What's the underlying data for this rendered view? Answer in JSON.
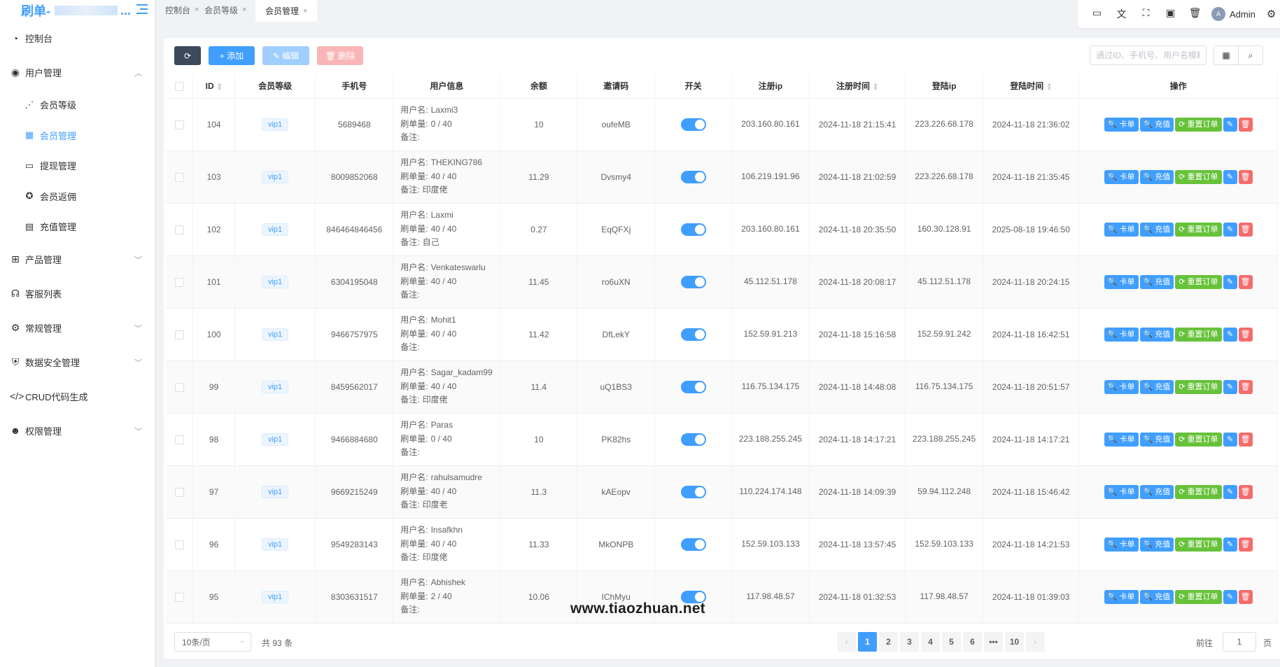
{
  "brand": {
    "title": "刷单-",
    "dots": "..."
  },
  "sidebar": {
    "items": [
      {
        "icon": "dashboard-icon",
        "glyph": "◔",
        "label": "控制台"
      },
      {
        "icon": "user-icon",
        "glyph": "◉",
        "label": "用户管理",
        "expanded": true,
        "children": [
          {
            "icon": "level-icon",
            "glyph": "⋰",
            "label": "会员等级"
          },
          {
            "icon": "grid-icon",
            "glyph": "▦",
            "label": "会员管理",
            "active": true
          },
          {
            "icon": "card-icon",
            "glyph": "▭",
            "label": "提现管理"
          },
          {
            "icon": "rebate-icon",
            "glyph": "✪",
            "label": "会员返佣"
          },
          {
            "icon": "briefcase-icon",
            "glyph": "▤",
            "label": "充值管理"
          }
        ]
      },
      {
        "icon": "product-icon",
        "glyph": "⊞",
        "label": "产品管理",
        "collapsed": true
      },
      {
        "icon": "headset-icon",
        "glyph": "☊",
        "label": "客服列表"
      },
      {
        "icon": "gears-icon",
        "glyph": "⚙",
        "label": "常规管理",
        "collapsed": true
      },
      {
        "icon": "shield-icon",
        "glyph": "⛨",
        "label": "数据安全管理",
        "collapsed": true
      },
      {
        "icon": "code-icon",
        "glyph": "</>",
        "label": "CRUD代码生成"
      },
      {
        "icon": "users-icon",
        "glyph": "☻",
        "label": "权限管理",
        "collapsed": true
      }
    ]
  },
  "tabs": [
    {
      "label": "控制台",
      "close": "×"
    },
    {
      "label": "会员等级",
      "close": "×"
    },
    {
      "label": "会员管理",
      "close": "×",
      "active": true
    }
  ],
  "topbar": {
    "icons": [
      "monitor-icon",
      "translate-icon",
      "fullscreen-icon",
      "terminal-icon",
      "trash-icon"
    ],
    "glyphs": [
      "▭",
      "文",
      "⛶",
      "▣",
      "🗑"
    ],
    "avatar_text": "A",
    "user": "Admin"
  },
  "toolbar": {
    "refresh": "⟳",
    "add": "+ 添加",
    "edit": "✎ 编辑",
    "delete": "🗑 删除",
    "search_placeholder": "通过ID、手机号、用户名模糊"
  },
  "table": {
    "columns": [
      "ID",
      "会员等级",
      "手机号",
      "用户信息",
      "余额",
      "邀请码",
      "开关",
      "注册ip",
      "注册时间",
      "登陆ip",
      "登陆时间",
      "操作"
    ],
    "info_labels": {
      "username": "用户名:",
      "orders": "刷单量:",
      "note": "备注:"
    },
    "op_labels": {
      "card": "🔍 卡单",
      "recharge": "🔍 充值",
      "reset": "⟳ 重置订单"
    },
    "rows": [
      {
        "id": "104",
        "level": "vip1",
        "phone": "5689468",
        "username": "Laxmi3",
        "orders": "0 / 40",
        "note": "",
        "balance": "10",
        "code": "oufeMB",
        "reg_ip": "203.160.80.161",
        "reg_time": "2024-11-18 21:15:41",
        "login_ip": "223.226.68.178",
        "login_time": "2024-11-18 21:36:02"
      },
      {
        "id": "103",
        "level": "vip1",
        "phone": "8009852068",
        "username": "THEKING786",
        "orders": "40 / 40",
        "note": "印度佬",
        "balance": "11.29",
        "code": "Dvsmy4",
        "reg_ip": "106.219.191.96",
        "reg_time": "2024-11-18 21:02:59",
        "login_ip": "223.226.68.178",
        "login_time": "2024-11-18 21:35:45"
      },
      {
        "id": "102",
        "level": "vip1",
        "phone": "846464846456",
        "username": "Laxmi",
        "orders": "40 / 40",
        "note": "自己",
        "balance": "0.27",
        "code": "EqQFXj",
        "reg_ip": "203.160.80.161",
        "reg_time": "2024-11-18 20:35:50",
        "login_ip": "160.30.128.91",
        "login_time": "2025-08-18 19:46:50"
      },
      {
        "id": "101",
        "level": "vip1",
        "phone": "6304195048",
        "username": "Venkateswarlu",
        "orders": "40 / 40",
        "note": "",
        "balance": "11.45",
        "code": "ro6uXN",
        "reg_ip": "45.112.51.178",
        "reg_time": "2024-11-18 20:08:17",
        "login_ip": "45.112.51.178",
        "login_time": "2024-11-18 20:24:15"
      },
      {
        "id": "100",
        "level": "vip1",
        "phone": "9466757975",
        "username": "Mohit1",
        "orders": "40 / 40",
        "note": "",
        "balance": "11.42",
        "code": "DfLekY",
        "reg_ip": "152.59.91.213",
        "reg_time": "2024-11-18 15:16:58",
        "login_ip": "152.59.91.242",
        "login_time": "2024-11-18 16:42:51"
      },
      {
        "id": "99",
        "level": "vip1",
        "phone": "8459562017",
        "username": "Sagar_kadam99",
        "orders": "40 / 40",
        "note": "印度佬",
        "balance": "11.4",
        "code": "uQ1BS3",
        "reg_ip": "116.75.134.175",
        "reg_time": "2024-11-18 14:48:08",
        "login_ip": "116.75.134.175",
        "login_time": "2024-11-18 20:51:57"
      },
      {
        "id": "98",
        "level": "vip1",
        "phone": "9466884680",
        "username": "Paras",
        "orders": "0 / 40",
        "note": "",
        "balance": "10",
        "code": "PK82hs",
        "reg_ip": "223.188.255.245",
        "reg_time": "2024-11-18 14:17:21",
        "login_ip": "223.188.255.245",
        "login_time": "2024-11-18 14:17:21"
      },
      {
        "id": "97",
        "level": "vip1",
        "phone": "9669215249",
        "username": "rahulsamudre",
        "orders": "40 / 40",
        "note": "印度老",
        "balance": "11.3",
        "code": "kAEopv",
        "reg_ip": "110.224.174.148",
        "reg_time": "2024-11-18 14:09:39",
        "login_ip": "59.94.112.248",
        "login_time": "2024-11-18 15:46:42"
      },
      {
        "id": "96",
        "level": "vip1",
        "phone": "9549283143",
        "username": "Insafkhn",
        "orders": "40 / 40",
        "note": "印度佬",
        "balance": "11.33",
        "code": "MkONPB",
        "reg_ip": "152.59.103.133",
        "reg_time": "2024-11-18 13:57:45",
        "login_ip": "152.59.103.133",
        "login_time": "2024-11-18 14:21:53"
      },
      {
        "id": "95",
        "level": "vip1",
        "phone": "8303631517",
        "username": "Abhishek",
        "orders": "2 / 40",
        "note": "",
        "balance": "10.06",
        "code": "IChMyu",
        "reg_ip": "117.98.48.57",
        "reg_time": "2024-11-18 01:32:53",
        "login_ip": "117.98.48.57",
        "login_time": "2024-11-18 01:39:03"
      }
    ]
  },
  "pagination": {
    "page_size": "10条/页",
    "total": "共 93 条",
    "prev": "‹",
    "next": "›",
    "pages": [
      "1",
      "2",
      "3",
      "4",
      "5",
      "6",
      "•••",
      "10"
    ],
    "current": "1",
    "goto_label": "前往",
    "goto_value": "1",
    "goto_suffix": "页"
  },
  "watermark": "www.tiaozhuan.net",
  "colors": {
    "primary": "#409eff",
    "success": "#67c23a",
    "danger": "#f56c6c",
    "dark": "#3c4a5b"
  }
}
